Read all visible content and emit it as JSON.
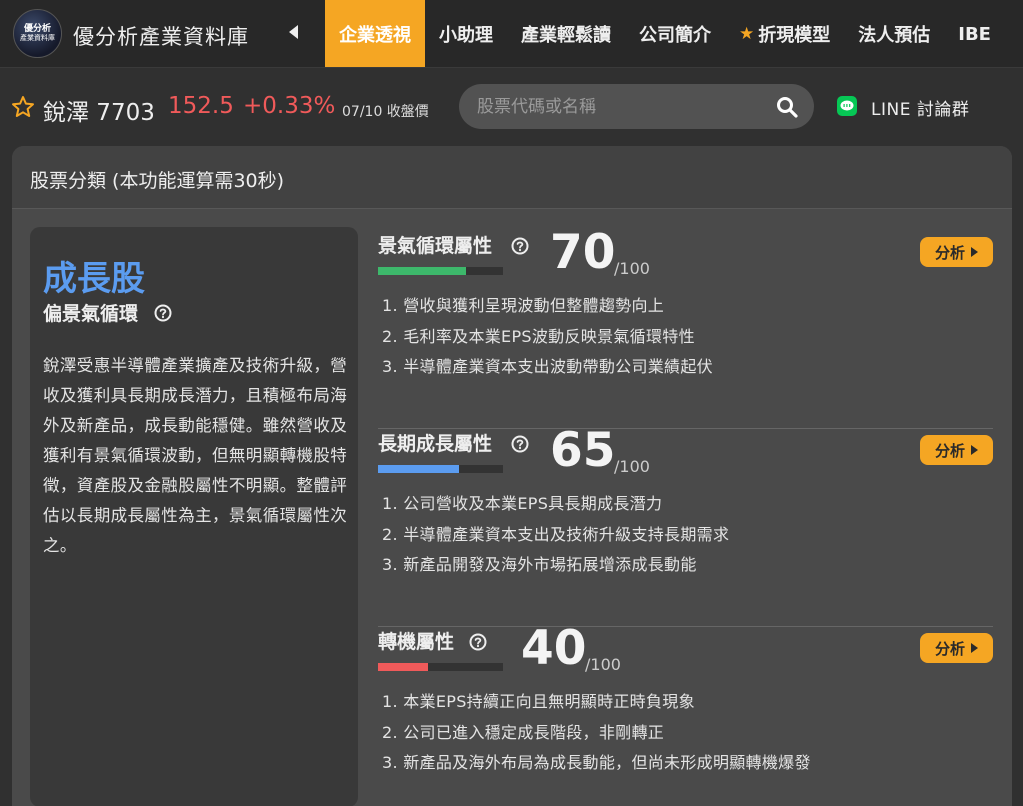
{
  "brand": {
    "logo_line1": "優分析",
    "logo_line2": "產業資料庫",
    "title": "優分析產業資料庫"
  },
  "nav": {
    "items": [
      {
        "label": "企業透視",
        "active": true,
        "star": false
      },
      {
        "label": "小助理",
        "active": false,
        "star": false
      },
      {
        "label": "產業輕鬆讀",
        "active": false,
        "star": false
      },
      {
        "label": "公司簡介",
        "active": false,
        "star": false
      },
      {
        "label": "折現模型",
        "active": false,
        "star": true
      },
      {
        "label": "法人預估",
        "active": false,
        "star": false
      },
      {
        "label": "IBE",
        "active": false,
        "star": false
      }
    ],
    "accent": "#f5a623"
  },
  "stock": {
    "name_code": "銳澤 7703",
    "price": "152.5",
    "change": "+0.33%",
    "date_status": "07/10 收盤價",
    "up_color": "#f05a5a"
  },
  "search": {
    "placeholder": "股票代碼或名稱",
    "value": ""
  },
  "line": {
    "label": "LINE 討論群"
  },
  "card": {
    "title": "股票分類 (本功能運算需30秒)"
  },
  "classification": {
    "main": "成長股",
    "sub": "偏景氣循環",
    "description": "銳澤受惠半導體產業擴產及技術升級，營收及獲利具長期成長潛力，且積極布局海外及新產品，成長動能穩健。雖然營收及獲利有景氣循環波動，但無明顯轉機股特徵，資產股及金融股屬性不明顯。整體評估以長期成長屬性為主，景氣循環屬性次之。",
    "main_color": "#5b9cf0"
  },
  "attributes": [
    {
      "title": "景氣循環屬性",
      "score": "70",
      "max": "/100",
      "fraction": 0.7,
      "bar_color": "#3db86b",
      "button": "分析",
      "points": [
        "1. 營收與獲利呈現波動但整體趨勢向上",
        "2. 毛利率及本業EPS波動反映景氣循環特性",
        "3. 半導體產業資本支出波動帶動公司業績起伏"
      ]
    },
    {
      "title": "長期成長屬性",
      "score": "65",
      "max": "/100",
      "fraction": 0.65,
      "bar_color": "#5b9cf0",
      "button": "分析",
      "points": [
        "1. 公司營收及本業EPS具長期成長潛力",
        "2. 半導體產業資本支出及技術升級支持長期需求",
        "3. 新產品開發及海外市場拓展增添成長動能"
      ]
    },
    {
      "title": "轉機屬性",
      "score": "40",
      "max": "/100",
      "fraction": 0.4,
      "bar_color": "#f05a5a",
      "button": "分析",
      "points": [
        "1. 本業EPS持續正向且無明顯時正時負現象",
        "2. 公司已進入穩定成長階段，非剛轉正",
        "3. 新產品及海外布局為成長動能，但尚未形成明顯轉機爆發"
      ]
    }
  ]
}
